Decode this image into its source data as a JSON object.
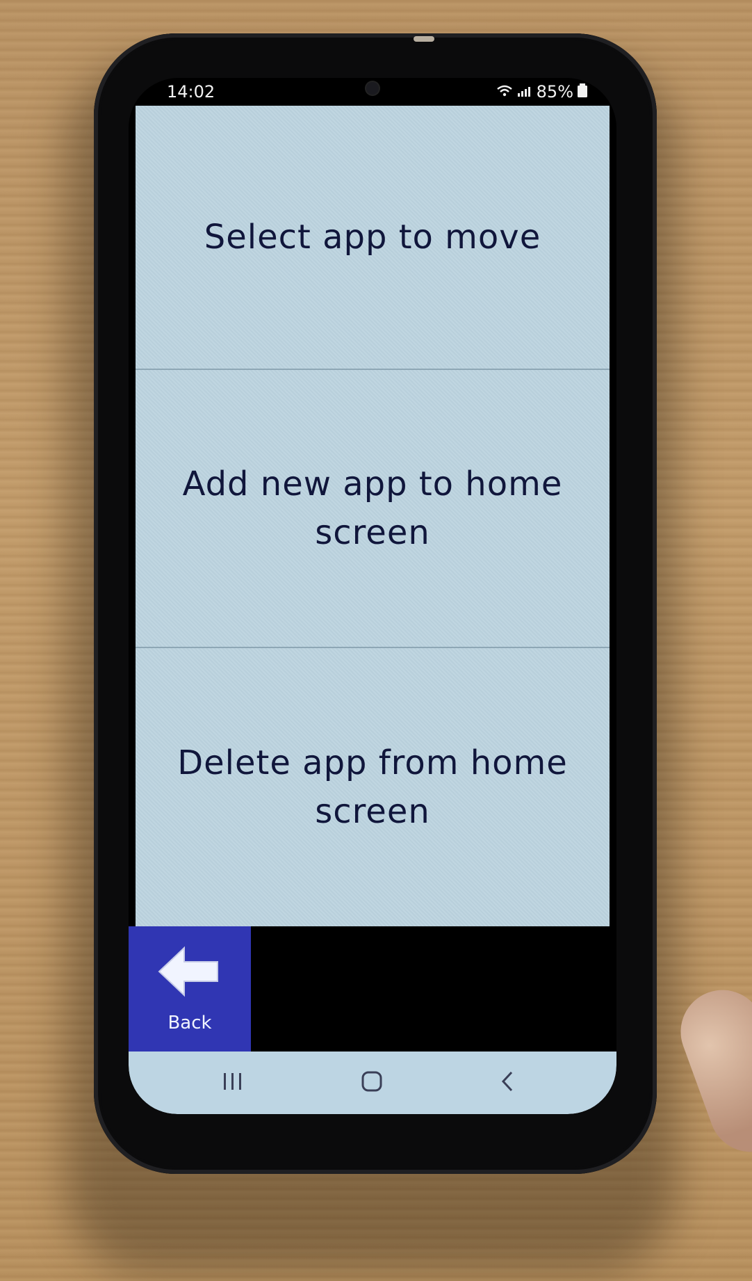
{
  "status_bar": {
    "time": "14:02",
    "battery_percent": "85%",
    "wifi_icon": "wifi-icon",
    "signal_icon": "signal-icon",
    "battery_icon": "battery-icon"
  },
  "menu": {
    "items": [
      {
        "label": "Select app to move"
      },
      {
        "label": "Add new app to home screen"
      },
      {
        "label": "Delete app from home screen"
      }
    ]
  },
  "bottom_bar": {
    "back_label": "Back",
    "back_icon": "arrow-left-icon",
    "back_color": "#3036b3"
  },
  "navigation": {
    "recent_icon": "recent-apps-icon",
    "home_icon": "home-icon",
    "back_icon": "back-chevron-icon"
  },
  "colors": {
    "menu_background": "#bcd3df",
    "menu_text": "#10163b",
    "navbar_background": "#bdd5e3"
  }
}
